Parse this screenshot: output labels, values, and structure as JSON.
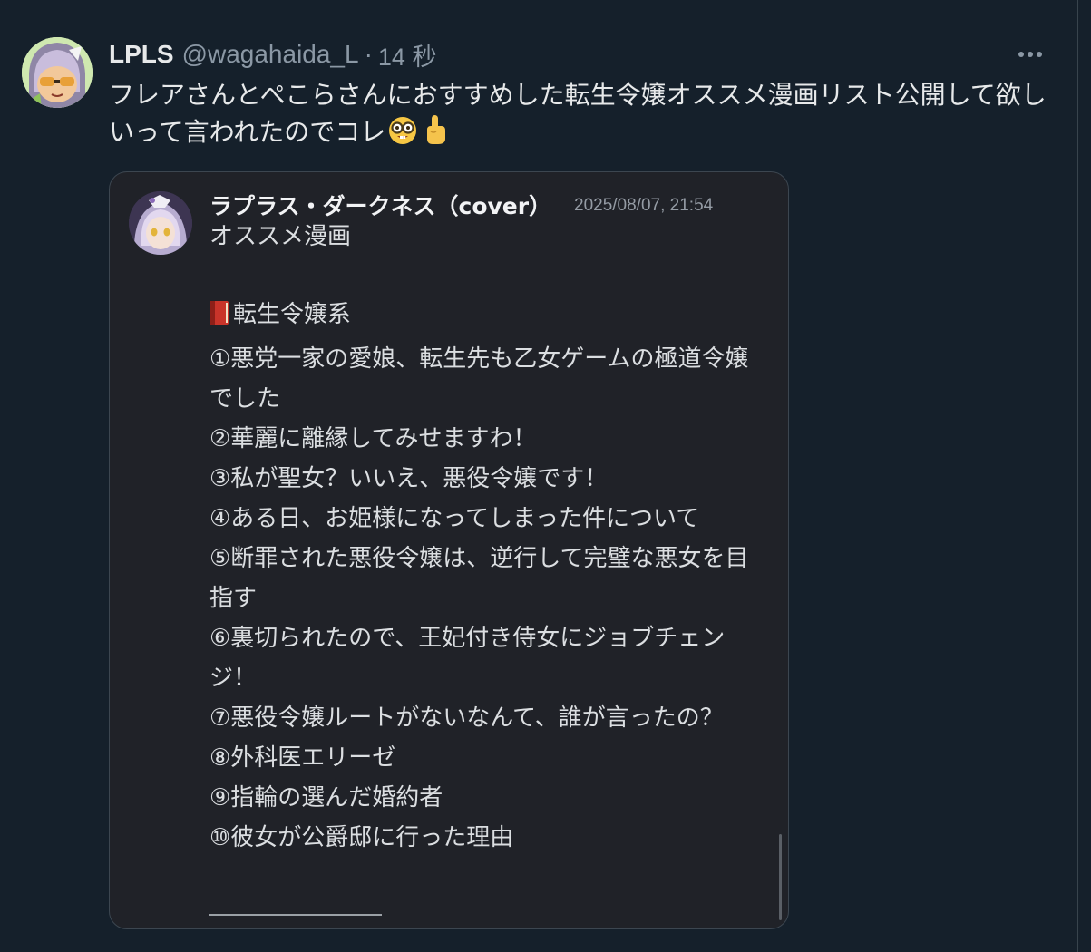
{
  "tweet": {
    "display_name": "LPLS",
    "handle": "@wagahaida_L",
    "separator": "·",
    "time": "14 秒",
    "text": "フレアさんとぺこらさんにおすすめした転生令嬢オススメ漫画リスト公開して欲しいって言われたのでコレ",
    "emojis": [
      "nerd-face-emoji",
      "pointing-up-emoji"
    ]
  },
  "card": {
    "author": "ラプラス・ダークネス（cover）",
    "date": "2025/08/07, 21:54",
    "subtitle": "オススメ漫画",
    "section_title": "転生令嬢系",
    "section_icon": "red-book-icon",
    "items": [
      "①悪党一家の愛娘、転生先も乙女ゲームの極道令嬢でした",
      "②華麗に離縁してみせますわ！",
      "③私が聖女？いいえ、悪役令嬢です！",
      "④ある日、お姫様になってしまった件について",
      "⑤断罪された悪役令嬢は、逆行して完璧な悪女を目指す",
      "⑥裏切られたので、王妃付き侍女にジョブチェンジ！",
      "⑦悪役令嬢ルートがないなんて、誰が言ったの？",
      "⑧外科医エリーゼ",
      "⑨指輪の選んだ婚約者",
      "⑩彼女が公爵邸に行った理由"
    ]
  },
  "colors": {
    "background": "#15202b",
    "card_background": "#202228",
    "muted_text": "#8b98a5"
  }
}
